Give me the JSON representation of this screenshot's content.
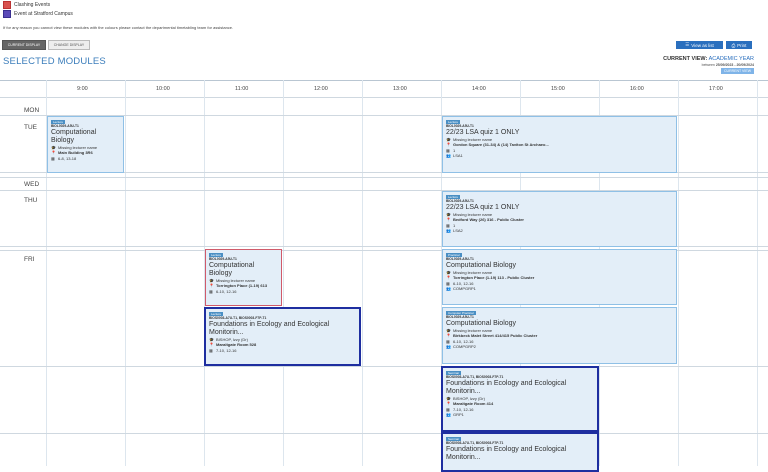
{
  "legend": [
    {
      "label": "Clashing Events",
      "color": "#d9534f"
    },
    {
      "label": "Event at Stratford Campus",
      "color": "#5b4ab8"
    }
  ],
  "note": "If for any reason you cannot view these modules with the colours please contact the departmental timetabling team for assistance.",
  "buttons": {
    "current_display": "CURRENT DISPLAY",
    "change_display": "CHANGE DISPLAY",
    "view_as_list": "View as list",
    "print": "Print"
  },
  "page_title": "SELECTED MODULES",
  "current_view": {
    "label": "CURRENT VIEW:",
    "value": "ACADEMIC YEAR",
    "dates_prefix": "between",
    "dates": "25/09/2023 - 20/09/2024",
    "button": "CURRENT VIEW"
  },
  "times": [
    "9:00",
    "10:00",
    "11:00",
    "12:00",
    "13:00",
    "14:00",
    "15:00",
    "16:00",
    "17:00"
  ],
  "days": [
    "MON",
    "TUE",
    "WED",
    "THU",
    "FRI"
  ],
  "events": [
    {
      "tag": "Lecture",
      "code": "BIOL0029-A5U-T1",
      "title": "Computational Biology",
      "lecturer": "Missing lecturer name",
      "location": "Main Building 3R6",
      "weeks": "6-8, 13-18",
      "extra": "",
      "style": ""
    },
    {
      "tag": "Lecture",
      "code": "BIOL0029-A5U-T1",
      "title": "22/23 LSA quiz 1 ONLY",
      "lecturer": "Missing lecturer name",
      "location": "Gordon Square (31-34) & (14) Taviton St Archaeo...",
      "weeks": "1",
      "extra": "LSA1",
      "style": ""
    },
    {
      "tag": "Lecture",
      "code": "BIOL0029-A5U-T1",
      "title": "22/23 LSA quiz 1 ONLY",
      "lecturer": "Missing lecturer name",
      "location": "Bedford Way (26) 316 - Public Cluster",
      "weeks": "1",
      "extra": "LSA2",
      "style": ""
    },
    {
      "tag": "Lecture",
      "code": "BIOL0029-A5U-T1",
      "title": "Computational Biology",
      "lecturer": "Missing lecturer name",
      "location": "Torrington Place (1-19) 613",
      "weeks": "6-10, 12-16",
      "extra": "",
      "style": "red"
    },
    {
      "tag": "Practical",
      "code": "BIOL0029-A5U-T1",
      "title": "Computational Biology",
      "lecturer": "Missing lecturer name",
      "location": "Torrington Place (1-19) 113 - Public Cluster",
      "weeks": "6-10, 12-16",
      "extra": "COMPGRP1",
      "style": ""
    },
    {
      "tag": "Lecture",
      "code": "BIOS0003-A7U-T1, BIOS0003-F7P-T1",
      "title": "Foundations in Ecology and Ecological Monitorin...",
      "lecturer": "BISHOP, Izzy (Dr)",
      "location": "Maraltgate Room 528",
      "weeks": "7-10, 12-16",
      "extra": "",
      "style": "navy"
    },
    {
      "tag": "Computer Practical",
      "code": "BIOL0029-A5U-T1",
      "title": "Computational Biology",
      "lecturer": "Missing lecturer name",
      "location": "Birkbeck Malet Street 414/415 Public Cluster",
      "weeks": "6-10, 12-16",
      "extra": "COMPGRP2",
      "style": ""
    },
    {
      "tag": "Seminar",
      "code": "BIOS0003-A7U-T1, BIOS0003-F7P-T1",
      "title": "Foundations in Ecology and Ecological Monitorin...",
      "lecturer": "BISHOP, Izzy (Dr)",
      "location": "Maraltgate Room 414",
      "weeks": "7-10, 12-16",
      "extra": "GRP1",
      "style": "navy"
    },
    {
      "tag": "Seminar",
      "code": "BIOS0003-A7U-T1, BIOS0003-F7P-T1",
      "title": "Foundations in Ecology and Ecological Monitorin...",
      "lecturer": "",
      "location": "",
      "weeks": "",
      "extra": "",
      "style": "navy"
    }
  ]
}
